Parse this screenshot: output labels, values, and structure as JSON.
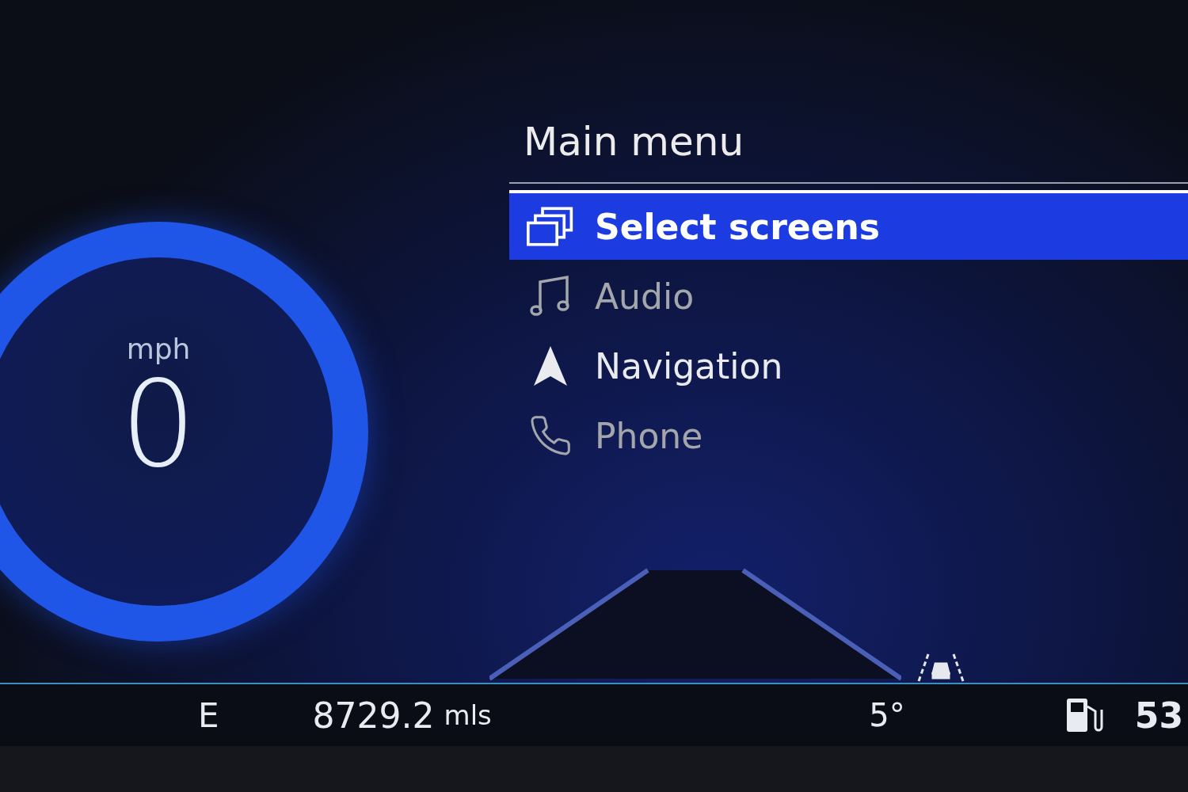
{
  "speedometer": {
    "unit": "mph",
    "speed": "0"
  },
  "menu": {
    "title": "Main menu",
    "items": [
      {
        "label": "Select screens",
        "selected": true,
        "disabled": false
      },
      {
        "label": "Audio",
        "selected": false,
        "disabled": true
      },
      {
        "label": "Navigation",
        "selected": false,
        "disabled": false
      },
      {
        "label": "Phone",
        "selected": false,
        "disabled": true
      }
    ]
  },
  "status_bar": {
    "gear": "E",
    "odometer": {
      "value": "8729.2",
      "unit": "mls"
    },
    "temperature": "5°",
    "fuel_range": "53"
  }
}
